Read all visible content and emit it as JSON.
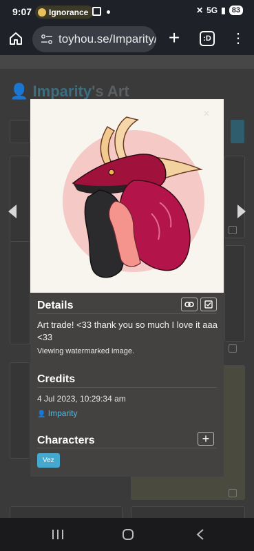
{
  "status_bar": {
    "time": "9:07",
    "media_label": "Ignorance",
    "network": "5G",
    "battery": "83"
  },
  "browser": {
    "url": "toyhou.se/Imparity/a",
    "tab_count": ":D"
  },
  "page": {
    "owner": "Imparity",
    "title_suffix": "'s Art"
  },
  "modal": {
    "details_title": "Details",
    "description": "Art trade! <33 thank you so much I love it aaa <33",
    "watermark_note": "Viewing watermarked image.",
    "credits_title": "Credits",
    "timestamp": "4 Jul 2023, 10:29:34 am",
    "credit_user": "Imparity",
    "characters_title": "Characters",
    "character_tag": "Vez"
  },
  "colors": {
    "accent": "#45a9cf",
    "modal_bg": "#444141",
    "image_bg": "#f8f4ee"
  }
}
